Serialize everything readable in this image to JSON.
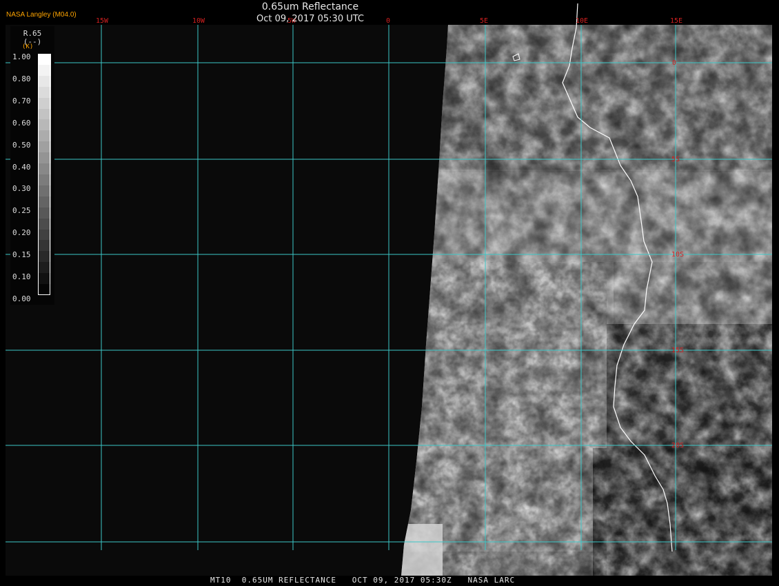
{
  "header": {
    "title": "0.65um Reflectance",
    "subtitle": "Oct 09, 2017 05:30 UTC",
    "credit": "NASA Langley (M04.0)"
  },
  "legend": {
    "variable": "R.65",
    "units": "(--)",
    "units_marker": "(K)",
    "ticks": [
      "1.00",
      "0.80",
      "0.70",
      "0.60",
      "0.50",
      "0.40",
      "0.30",
      "0.25",
      "0.20",
      "0.15",
      "0.10",
      "0.00"
    ]
  },
  "grid": {
    "longitude_labels": [
      "15W",
      "10W",
      "5W",
      "0",
      "5E",
      "10E",
      "15E"
    ],
    "latitude_labels": [
      "0",
      "5S",
      "10S",
      "15S",
      "20S"
    ],
    "line_color": "#3cc8c8",
    "label_color": "#d42020"
  },
  "map": {
    "background": "#0a0a0a",
    "coastline_color": "#ffffff"
  },
  "footer": {
    "text": "MT10  0.65UM REFLECTANCE   OCT 09, 2017 05:30Z   NASA LARC"
  }
}
